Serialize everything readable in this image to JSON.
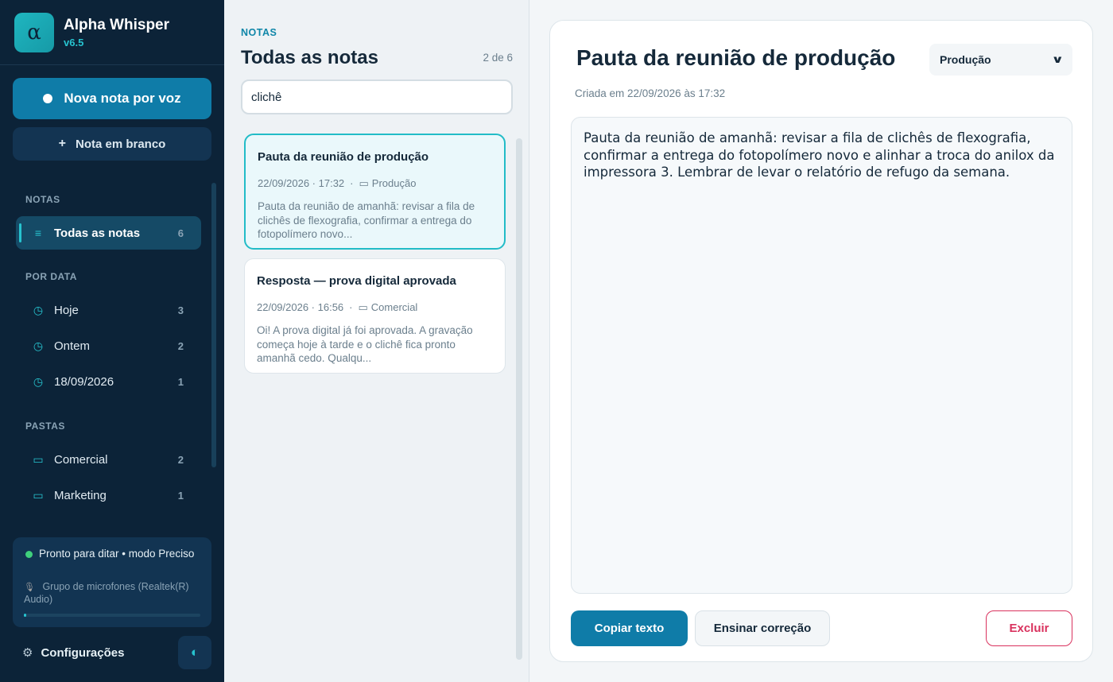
{
  "app": {
    "logo_glyph": "α",
    "name": "Alpha Whisper",
    "version": "v6.5"
  },
  "sidebar": {
    "new_voice_label": "Nova nota por voz",
    "blank_note_label": "Nota em branco",
    "blank_note_icon": "+",
    "sections": {
      "notes": "NOTAS",
      "by_date": "POR DATA",
      "folders": "PASTAS"
    },
    "notes_items": [
      {
        "icon": "≡",
        "label": "Todas as notas",
        "count": "6",
        "active": true
      }
    ],
    "date_items": [
      {
        "icon": "◷",
        "label": "Hoje",
        "count": "3"
      },
      {
        "icon": "◷",
        "label": "Ontem",
        "count": "2"
      },
      {
        "icon": "◷",
        "label": "18/09/2026",
        "count": "1"
      }
    ],
    "folder_items": [
      {
        "icon": "▭",
        "label": "Comercial",
        "count": "2"
      },
      {
        "icon": "▭",
        "label": "Marketing",
        "count": "1"
      }
    ],
    "status": {
      "text": "Pronto para ditar  •  modo Preciso",
      "mic_icon": "🎙",
      "mic_text": "Grupo de microfones (Realtek(R) Audio)",
      "level": 0.01,
      "status_color": "#3fd07c"
    },
    "settings_icon": "⚙",
    "settings_label": "Configurações",
    "theme_icon": "◐"
  },
  "list": {
    "eyebrow": "NOTAS",
    "title": "Todas as notas",
    "count_text": "2 de 6",
    "search_value": "clichê",
    "notes": [
      {
        "title": "Pauta da reunião de produção",
        "date": "22/09/2026 · 17:32",
        "sep": "·",
        "folder_icon": "▭",
        "folder": "Produção",
        "excerpt": "Pauta da reunião de amanhã: revisar a fila de clichês de flexografia, confirmar a entrega do fotopolímero novo...",
        "selected": true
      },
      {
        "title": "Resposta — prova digital aprovada",
        "date": "22/09/2026 · 16:56",
        "sep": "·",
        "folder_icon": "▭",
        "folder": "Comercial",
        "excerpt": "Oi! A prova digital já foi aprovada. A gravação começa hoje à tarde e o clichê fica pronto amanhã cedo. Qualqu...",
        "selected": false
      }
    ]
  },
  "detail": {
    "title": "Pauta da reunião de produção",
    "folder_value": "Produção",
    "chevron_icon": "⌄",
    "created": "Criada em 22/09/2026 às 17:32",
    "body": "Pauta da reunião de amanhã: revisar a fila de clichês de flexografia, confirmar a entrega do fotopolímero novo e alinhar a troca do anilox da impressora 3. Lembrar de levar o relatório de refugo da semana.",
    "copy_label": "Copiar texto",
    "teach_label": "Ensinar correção",
    "delete_label": "Excluir"
  },
  "colors": {
    "accent": "#27c3cf",
    "primary": "#0f7ca8",
    "danger": "#d9325e",
    "sidebar_bg": "#0c2338"
  }
}
